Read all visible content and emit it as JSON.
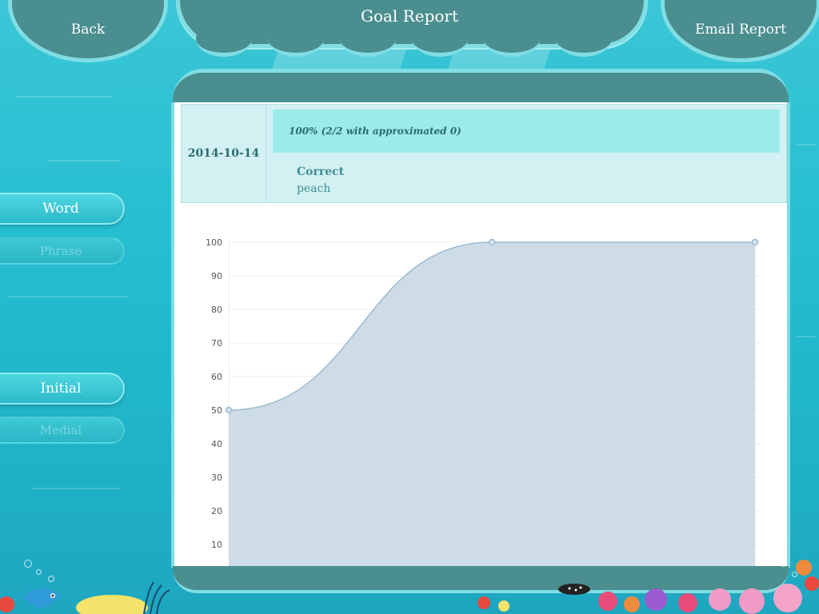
{
  "header": {
    "title": "Goal Report",
    "back_label": "Back",
    "email_label": "Email Report"
  },
  "sidebar": {
    "level_buttons": [
      {
        "label": "Word",
        "active": true
      },
      {
        "label": "Phrase",
        "active": false
      }
    ],
    "position_buttons": [
      {
        "label": "Initial",
        "active": true
      },
      {
        "label": "Medial",
        "active": false
      }
    ]
  },
  "report": {
    "date": "2014-10-14",
    "score": "100% (2/2 with approximated 0)",
    "result_label": "Correct",
    "words": "peach"
  },
  "chart_data": {
    "type": "area",
    "x": [
      1,
      2,
      3
    ],
    "values": [
      50,
      100,
      100
    ],
    "yticks": [
      10,
      20,
      30,
      40,
      50,
      60,
      70,
      80,
      90,
      100
    ],
    "ylim": [
      0,
      100
    ],
    "fill_color": "#cddce6",
    "line_color": "#9bbcd0"
  },
  "colors": {
    "panel_teal": "#4b8e8f",
    "panel_border": "#7fdde3",
    "row_bg": "#d3f1f3",
    "score_bg": "#9cebe9"
  }
}
